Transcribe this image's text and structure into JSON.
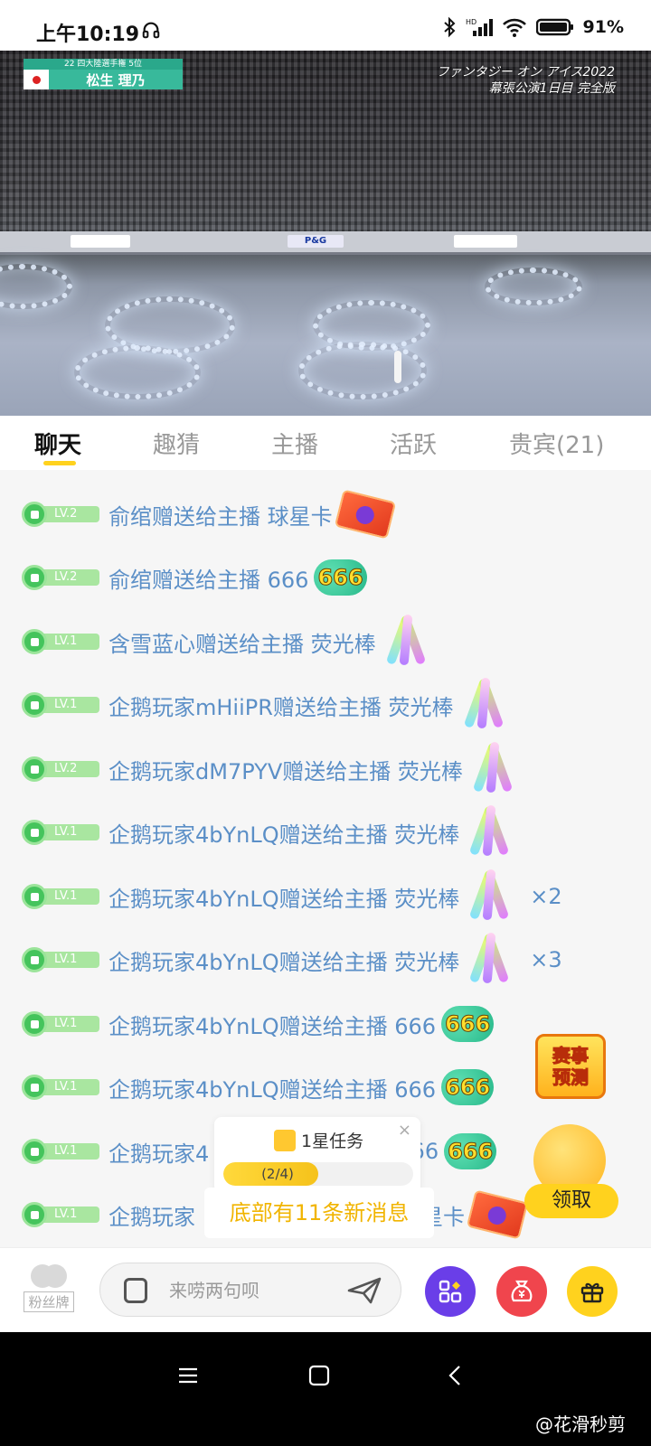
{
  "status_bar": {
    "time": "上午10:19",
    "network": "HD",
    "battery": "91%"
  },
  "video": {
    "name_tag_top": "22 四大陸選手権 5位",
    "skater_name": "松生 理乃",
    "title_line1": "ファンタジー オン アイス2022",
    "title_line2": "幕張公演1日目 完全版",
    "signs": [
      "P&G"
    ]
  },
  "tabs": [
    {
      "label": "聊天",
      "active": true
    },
    {
      "label": "趣猜",
      "active": false
    },
    {
      "label": "主播",
      "active": false
    },
    {
      "label": "活跃",
      "active": false
    },
    {
      "label": "贵宾(21)",
      "active": false
    }
  ],
  "messages": [
    {
      "level": "LV.2",
      "text": "俞绾赠送给主播 球星卡",
      "gift": "card",
      "count": ""
    },
    {
      "level": "LV.2",
      "text": "俞绾赠送给主播 666",
      "gift": "666",
      "count": ""
    },
    {
      "level": "LV.1",
      "text": "含雪蓝心赠送给主播 荧光棒",
      "gift": "glowstick",
      "count": ""
    },
    {
      "level": "LV.1",
      "text": "企鹅玩家mHiiPR赠送给主播 荧光棒",
      "gift": "glowstick",
      "count": ""
    },
    {
      "level": "LV.2",
      "text": "企鹅玩家dM7PYV赠送给主播 荧光棒",
      "gift": "glowstick",
      "count": ""
    },
    {
      "level": "LV.1",
      "text": "企鹅玩家4bYnLQ赠送给主播 荧光棒",
      "gift": "glowstick",
      "count": ""
    },
    {
      "level": "LV.1",
      "text": "企鹅玩家4bYnLQ赠送给主播 荧光棒",
      "gift": "glowstick",
      "count": "×2"
    },
    {
      "level": "LV.1",
      "text": "企鹅玩家4bYnLQ赠送给主播 荧光棒",
      "gift": "glowstick",
      "count": "×3"
    },
    {
      "level": "LV.1",
      "text": "企鹅玩家4bYnLQ赠送给主播 666",
      "gift": "666",
      "count": ""
    },
    {
      "level": "LV.1",
      "text": "企鹅玩家4bYnLQ赠送给主播 666",
      "gift": "666",
      "count": ""
    },
    {
      "level": "LV.1",
      "text": "企鹅玩家4",
      "tail": "666",
      "gift": "666",
      "count": ""
    },
    {
      "level": "LV.1",
      "text": "企鹅玩家",
      "tail": "球星卡",
      "gift": "card",
      "count": ""
    }
  ],
  "gift_666_label": "666",
  "event_button": {
    "line1": "赛事",
    "line2": "预测"
  },
  "task": {
    "title": "1星任务",
    "progress_text": "(2/4)",
    "progress": 0.5,
    "close": "×"
  },
  "claim_button": "领取",
  "new_messages_banner": "底部有11条新消息",
  "input_bar": {
    "fan_badge": "粉丝牌",
    "placeholder": "来唠两句呗"
  },
  "watermark": "@花滑秒剪",
  "colors": {
    "accent": "#ffd21e",
    "message_text": "#5b8fc7",
    "level_badge": "#a9e6a0"
  }
}
